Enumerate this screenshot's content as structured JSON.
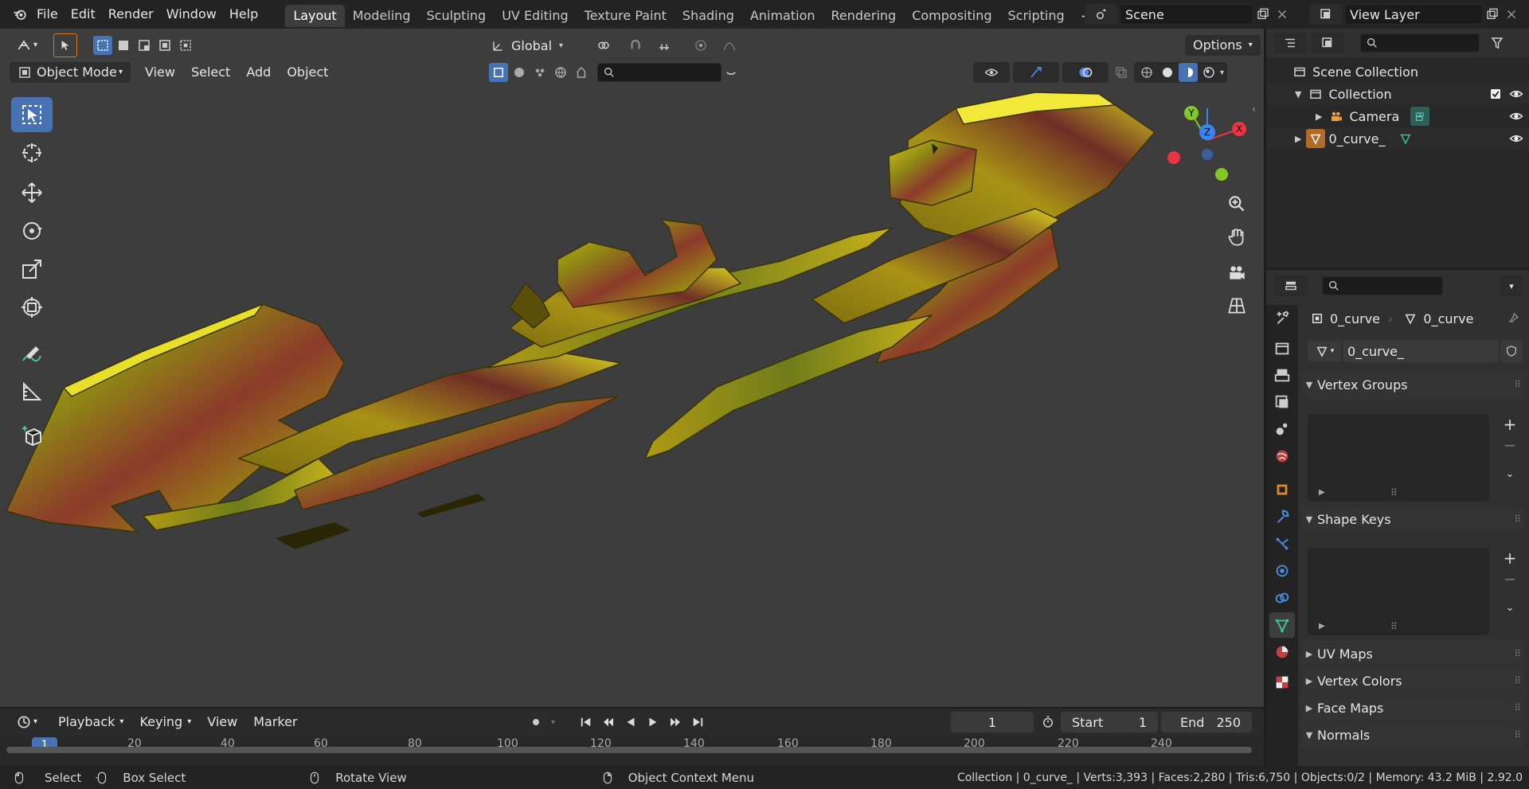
{
  "topbar": {
    "menus": [
      "File",
      "Edit",
      "Render",
      "Window",
      "Help"
    ],
    "workspaces": [
      "Layout",
      "Modeling",
      "Sculpting",
      "UV Editing",
      "Texture Paint",
      "Shading",
      "Animation",
      "Rendering",
      "Compositing",
      "Scripting"
    ],
    "active_workspace": "Layout",
    "scene_name": "Scene",
    "view_layer_name": "View Layer"
  },
  "viewport": {
    "transform_orientation": "Global",
    "options_label": "Options",
    "mode": "Object Mode",
    "header_menus": [
      "View",
      "Select",
      "Add",
      "Object"
    ],
    "gizmo": {
      "x": "X",
      "y": "Y",
      "z": "Z"
    }
  },
  "outliner": {
    "rows": [
      {
        "label": "Scene Collection"
      },
      {
        "label": "Collection"
      },
      {
        "label": "Camera"
      },
      {
        "label": "0_curve_"
      }
    ]
  },
  "properties": {
    "object_name": "0_curve",
    "mesh_name": "0_curve",
    "data_name": "0_curve_",
    "panels": {
      "vertex_groups": "Vertex Groups",
      "shape_keys": "Shape Keys",
      "uv_maps": "UV Maps",
      "vertex_colors": "Vertex Colors",
      "face_maps": "Face Maps",
      "normals": "Normals"
    }
  },
  "timeline": {
    "menus": [
      "Playback",
      "Keying",
      "View",
      "Marker"
    ],
    "current_frame": "1",
    "start_label": "Start",
    "start_value": "1",
    "end_label": "End",
    "end_value": "250",
    "ruler": [
      "1",
      "20",
      "40",
      "60",
      "80",
      "100",
      "120",
      "140",
      "160",
      "180",
      "200",
      "220",
      "240"
    ]
  },
  "statusbar": {
    "select": "Select",
    "box_select": "Box Select",
    "rotate_view": "Rotate View",
    "context_menu": "Object Context Menu",
    "stats": "Collection | 0_curve_ | Verts:3,393 | Faces:2,280 | Tris:6,750 | Objects:0/2 | Memory: 43.2 MiB | 2.92.0"
  },
  "colors": {
    "accent": "#4772b3",
    "viewport_bg": "#3d3d3d",
    "object_gold": "#b39a12",
    "axis_x": "#ee3344",
    "axis_y": "#83c926",
    "axis_z": "#3b83ee"
  }
}
